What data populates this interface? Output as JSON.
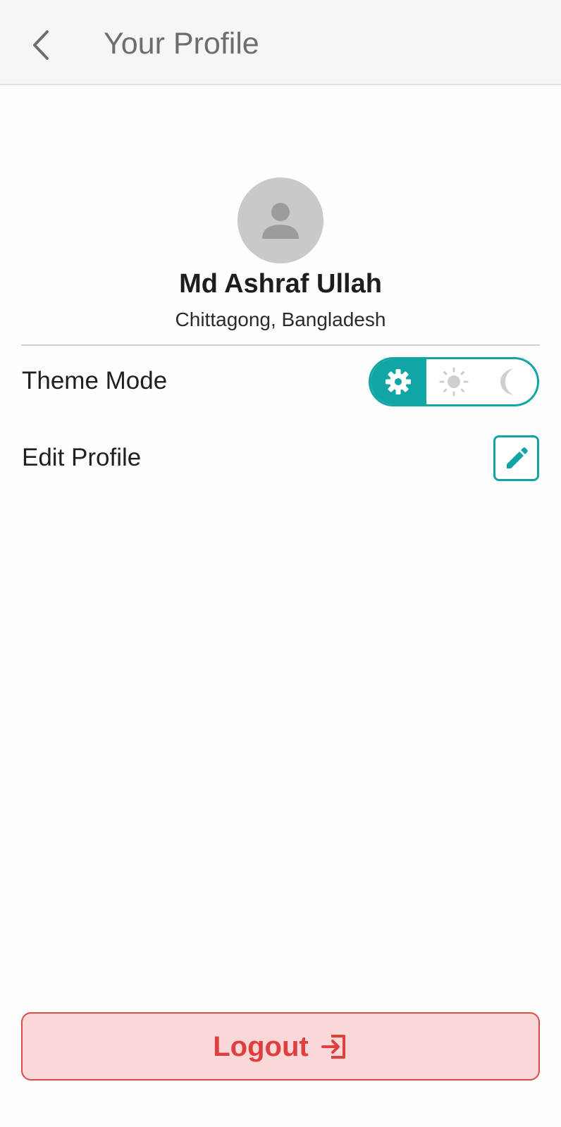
{
  "appbar": {
    "back_icon": "chevron-left-icon",
    "title": "Your Profile"
  },
  "profile": {
    "avatar_icon": "person-icon",
    "name": "Md Ashraf Ullah",
    "location": "Chittagong, Bangladesh"
  },
  "settings": {
    "theme_mode": {
      "label": "Theme Mode",
      "options": [
        {
          "icon": "gear-icon",
          "meaning": "system"
        },
        {
          "icon": "sun-icon",
          "meaning": "light"
        },
        {
          "icon": "moon-icon",
          "meaning": "dark"
        }
      ],
      "selected_index": 0
    },
    "edit_profile": {
      "label": "Edit Profile",
      "icon": "pencil-icon"
    }
  },
  "logout": {
    "label": "Logout",
    "icon": "logout-icon"
  },
  "colors": {
    "accent": "#12a5a5",
    "danger": "#df3f3f",
    "danger_bg": "#f9d8d8",
    "appbar_bg": "#f4f7f8",
    "avatar_bg": "#c9c9c9"
  }
}
